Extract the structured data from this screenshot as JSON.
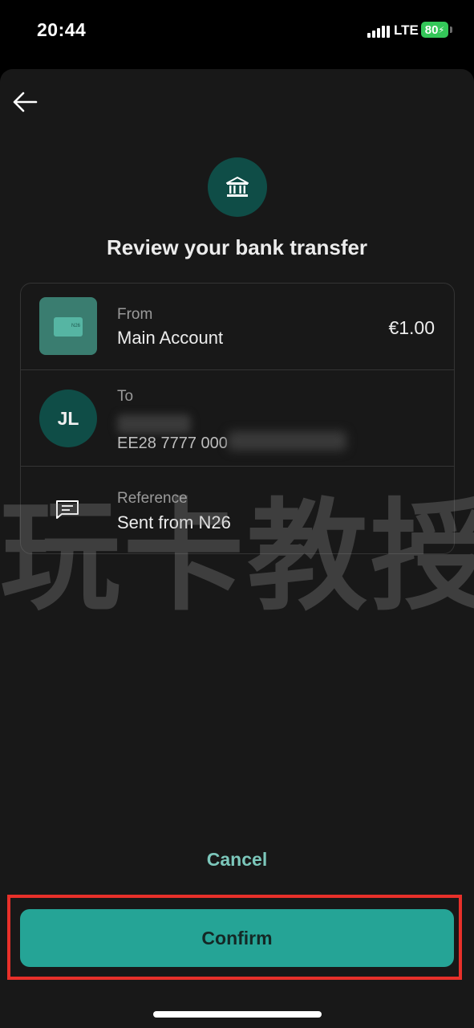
{
  "status_bar": {
    "time": "20:44",
    "network": "LTE",
    "battery": "80"
  },
  "header": {
    "back_icon": "arrow-left-icon",
    "bank_icon": "bank-building-icon",
    "title": "Review your bank transfer"
  },
  "from": {
    "label": "From",
    "account": "Main Account",
    "amount": "€1.00",
    "icon": "wallet-icon"
  },
  "to": {
    "label": "To",
    "initials": "JL",
    "iban_visible": "EE28 7777 000"
  },
  "reference": {
    "label": "Reference",
    "value": "Sent from N26",
    "icon": "message-icon"
  },
  "watermark": "玩卡教授",
  "actions": {
    "cancel_label": "Cancel",
    "confirm_label": "Confirm"
  },
  "colors": {
    "accent": "#25a496",
    "dark_teal": "#0f4d47",
    "highlight": "#e8302a",
    "background": "#181818"
  }
}
